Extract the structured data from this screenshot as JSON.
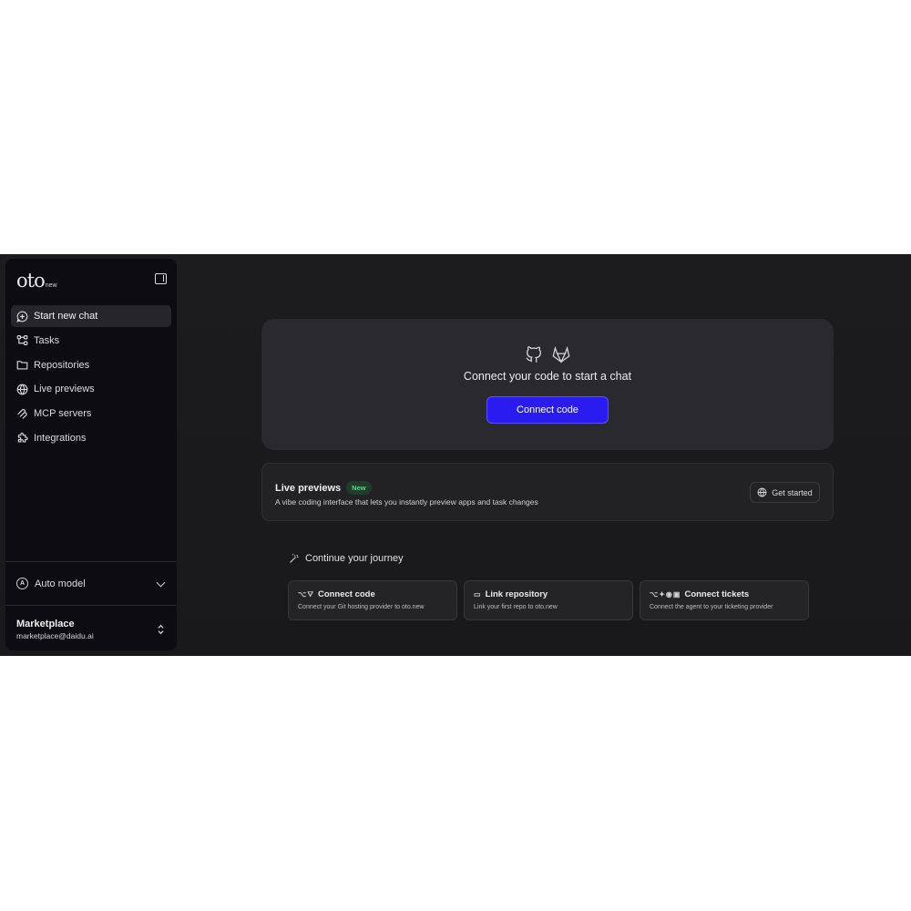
{
  "brand": {
    "logo_main": "oto",
    "logo_suffix": "new"
  },
  "sidebar": {
    "items": [
      {
        "label": "Start new chat",
        "icon": "chat-plus-icon",
        "active": true
      },
      {
        "label": "Tasks",
        "icon": "tasks-icon"
      },
      {
        "label": "Repositories",
        "icon": "folder-icon"
      },
      {
        "label": "Live previews",
        "icon": "globe-icon"
      },
      {
        "label": "MCP servers",
        "icon": "mcp-icon"
      },
      {
        "label": "Integrations",
        "icon": "puzzle-icon"
      }
    ],
    "model_label": "Auto model",
    "model_icon_letter": "A",
    "account": {
      "name": "Marketplace",
      "email": "marketplace@daidu.ai"
    }
  },
  "hero": {
    "title": "Connect your code to start a chat",
    "button": "Connect code",
    "icons": [
      "github-icon",
      "gitlab-icon"
    ]
  },
  "live_previews": {
    "title": "Live previews",
    "badge": "New",
    "description": "A vibe coding interface that lets you instantly preview apps and task changes",
    "button": "Get started"
  },
  "journey": {
    "title": "Continue your journey",
    "cards": [
      {
        "title": "Connect code",
        "description": "Connect your Git hosting provider to oto.new",
        "icons": "github-icon gitlab-icon"
      },
      {
        "title": "Link repository",
        "description": "Link your first repo to oto.new",
        "icons": "folder-icon"
      },
      {
        "title": "Connect tickets",
        "description": "Connect the agent to your ticketing provider",
        "icons": "github-icon jira-icon linear-icon notion-icon"
      }
    ]
  },
  "colors": {
    "accent": "#2a1cf0",
    "badge_green": "#63d28a",
    "background": "#1c1c1f",
    "sidebar": "#0d0c12"
  }
}
